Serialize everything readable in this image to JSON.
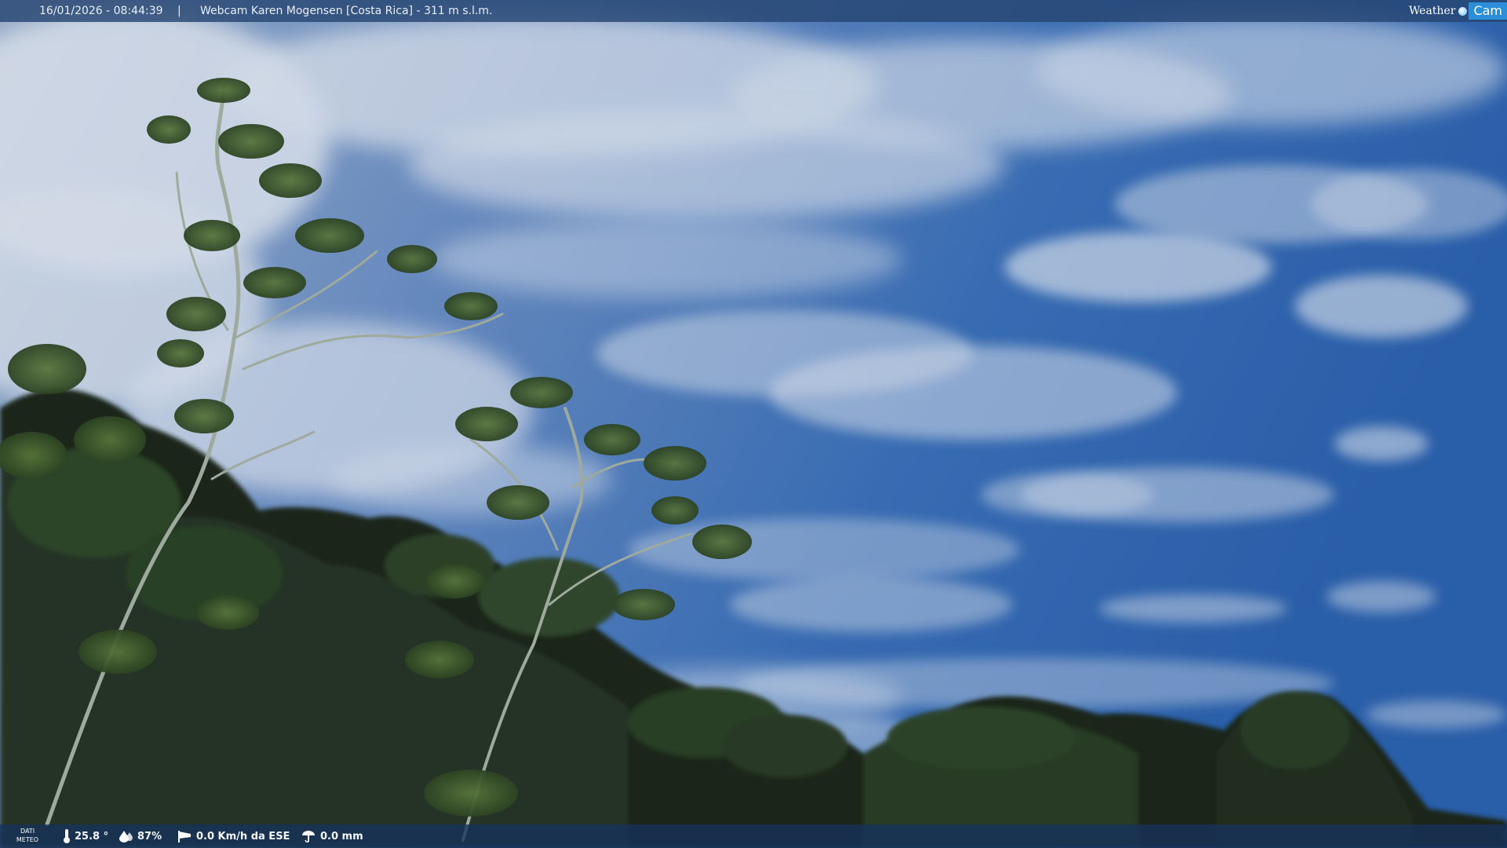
{
  "header": {
    "datetime": "16/01/2026 - 08:44:39",
    "separator": "|",
    "title": "Webcam Karen Mogensen [Costa Rica]  - 311 m s.l.m.",
    "brand_weather": "Weather",
    "brand_cam": "Cam"
  },
  "weather_bar": {
    "label_line1": "DATI",
    "label_line2": "METEO",
    "temperature": "25.8 °",
    "humidity": "87%",
    "wind": "0.0 Km/h da ESE",
    "rain": "0.0 mm",
    "icons": [
      "thermometer-icon",
      "humidity-drop-icon",
      "wind-sock-icon",
      "rain-gauge-icon"
    ]
  },
  "colors": {
    "sky_blue": "#2f66b3",
    "cloud_white": "#e9eef5",
    "foliage_dark": "#1f2d1a",
    "bar_blue": "#1b3a66"
  }
}
